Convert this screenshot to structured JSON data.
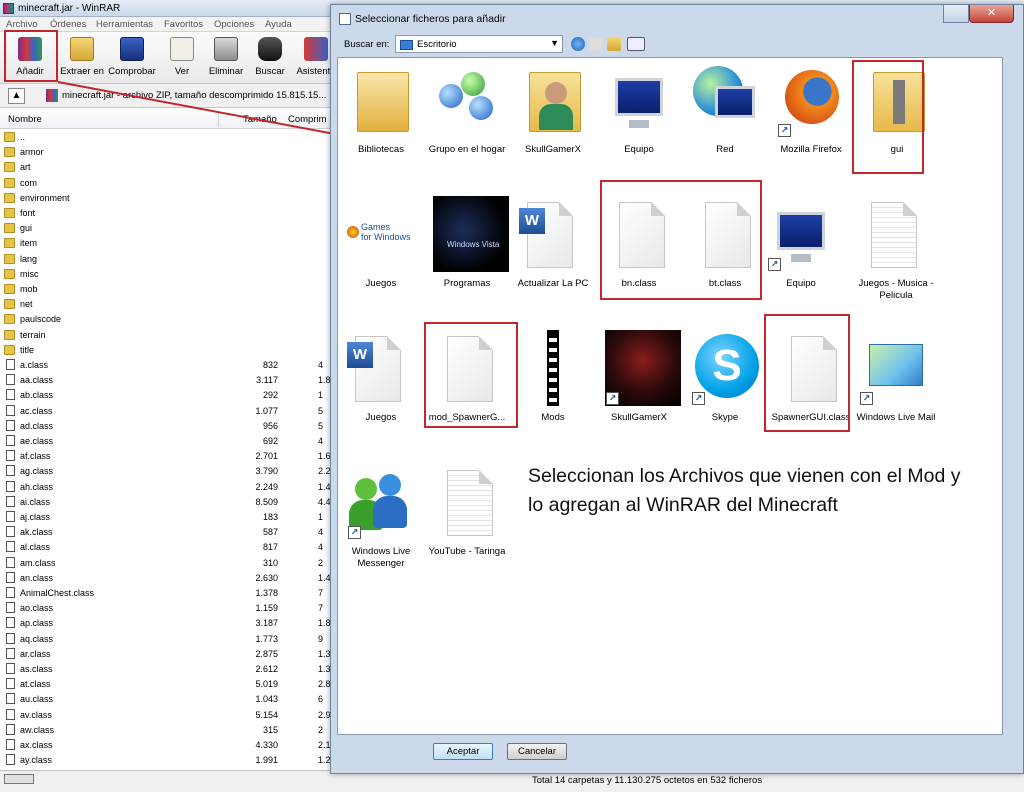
{
  "window": {
    "title": "minecraft.jar - WinRAR"
  },
  "menu": [
    "Archivo",
    "Órdenes",
    "Herramientas",
    "Favoritos",
    "Opciones",
    "Ayuda"
  ],
  "toolbar": [
    "Añadir",
    "Extraer en",
    "Comprobar",
    "Ver",
    "Eliminar",
    "Buscar",
    "Asistente"
  ],
  "pathbar": {
    "text": "minecraft.jar - archivo ZIP, tamaño descomprimido 15.815.15..."
  },
  "columns": {
    "name": "Nombre",
    "size": "Tamaño",
    "compressed": "Comprim"
  },
  "folders": [
    "..",
    "armor",
    "art",
    "com",
    "environment",
    "font",
    "gui",
    "item",
    "lang",
    "misc",
    "mob",
    "net",
    "paulscode",
    "terrain",
    "title"
  ],
  "files": [
    {
      "n": "a.class",
      "s": "832",
      "c": "4"
    },
    {
      "n": "aa.class",
      "s": "3.117",
      "c": "1.8"
    },
    {
      "n": "ab.class",
      "s": "292",
      "c": "1"
    },
    {
      "n": "ac.class",
      "s": "1.077",
      "c": "5"
    },
    {
      "n": "ad.class",
      "s": "956",
      "c": "5"
    },
    {
      "n": "ae.class",
      "s": "692",
      "c": "4"
    },
    {
      "n": "af.class",
      "s": "2.701",
      "c": "1.6"
    },
    {
      "n": "ag.class",
      "s": "3.790",
      "c": "2.2"
    },
    {
      "n": "ah.class",
      "s": "2.249",
      "c": "1.4"
    },
    {
      "n": "ai.class",
      "s": "8.509",
      "c": "4.4"
    },
    {
      "n": "aj.class",
      "s": "183",
      "c": "1"
    },
    {
      "n": "ak.class",
      "s": "587",
      "c": "4"
    },
    {
      "n": "al.class",
      "s": "817",
      "c": "4"
    },
    {
      "n": "am.class",
      "s": "310",
      "c": "2"
    },
    {
      "n": "an.class",
      "s": "2.630",
      "c": "1.4"
    },
    {
      "n": "AnimalChest.class",
      "s": "1.378",
      "c": "7"
    },
    {
      "n": "ao.class",
      "s": "1.159",
      "c": "7"
    },
    {
      "n": "ap.class",
      "s": "3.187",
      "c": "1.8"
    },
    {
      "n": "aq.class",
      "s": "1.773",
      "c": "9"
    },
    {
      "n": "ar.class",
      "s": "2.875",
      "c": "1.3"
    },
    {
      "n": "as.class",
      "s": "2.612",
      "c": "1.3"
    },
    {
      "n": "at.class",
      "s": "5.019",
      "c": "2.8"
    },
    {
      "n": "au.class",
      "s": "1.043",
      "c": "6"
    },
    {
      "n": "av.class",
      "s": "5.154",
      "c": "2.9"
    },
    {
      "n": "aw.class",
      "s": "315",
      "c": "2"
    },
    {
      "n": "ax.class",
      "s": "4.330",
      "c": "2.1"
    },
    {
      "n": "ay.class",
      "s": "1.991",
      "c": "1.2"
    }
  ],
  "status": {
    "text": "Total 14 carpetas y 11.130.275 octetos en 532 ficheros"
  },
  "dialog": {
    "title": "Seleccionar ficheros para añadir",
    "look_in_label": "Buscar en:",
    "look_in_value": "Escritorio",
    "accept": "Aceptar",
    "cancel": "Cancelar",
    "items": [
      "Bibliotecas",
      "Grupo en el hogar",
      "SkullGamerX",
      "Equipo",
      "Red",
      "Mozilla Firefox",
      "gui",
      "Juegos",
      "Programas",
      "Actualizar La PC",
      "bn.class",
      "bt.class",
      "Equipo",
      "Juegos - Musica - Pelicula",
      "Juegos",
      "mod_SpawnerG...",
      "Mods",
      "SkullGamerX",
      "Skype",
      "SpawnerGUI.class",
      "Windows Live Mail",
      "Windows Live Messenger",
      "YouTube - Taringa"
    ],
    "thumb_texts": {
      "games_line1": "Games",
      "games_line2": "for Windows",
      "vista": "Windows Vista"
    },
    "note": "Seleccionan los Archivos que vienen con el Mod y lo agregan al WinRAR del Minecraft"
  },
  "colors": {
    "highlight": "#c0272d",
    "dialog_frame": "#cbd9ea"
  }
}
